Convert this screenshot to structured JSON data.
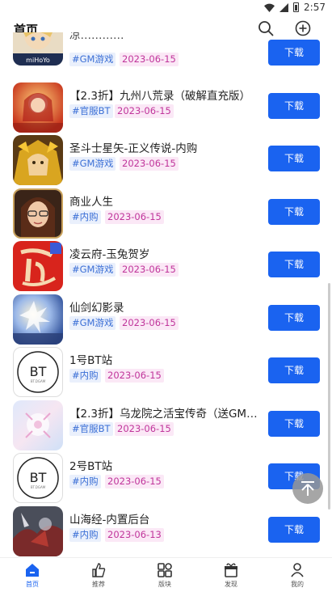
{
  "status_bar": {
    "time": "2:57"
  },
  "header": {
    "title": "首页"
  },
  "games": [
    {
      "title": "凉…………",
      "type_tag": "#GM游戏",
      "date": "2023-06-15",
      "button": "下载"
    },
    {
      "title": "【2.3折】九州八荒录（破解直充版）",
      "type_tag": "#官服BT",
      "date": "2023-06-15",
      "button": "下载"
    },
    {
      "title": "圣斗士星矢-正义传说-内购",
      "type_tag": "#GM游戏",
      "date": "2023-06-15",
      "button": "下载"
    },
    {
      "title": "商业人生",
      "type_tag": "#内购",
      "date": "2023-06-15",
      "button": "下载"
    },
    {
      "title": "凌云府-玉兔贺岁",
      "type_tag": "#GM游戏",
      "date": "2023-06-15",
      "button": "下载"
    },
    {
      "title": "仙剑幻影录",
      "type_tag": "#GM游戏",
      "date": "2023-06-15",
      "button": "下载"
    },
    {
      "title": "1号BT站",
      "type_tag": "#内购",
      "date": "2023-06-15",
      "button": "下载"
    },
    {
      "title": "【2.3折】乌龙院之活宝传奇（送GM…",
      "type_tag": "#官服BT",
      "date": "2023-06-15",
      "button": "下载"
    },
    {
      "title": "2号BT站",
      "type_tag": "#内购",
      "date": "2023-06-15",
      "button": "下载"
    },
    {
      "title": "山海经-内置后台",
      "type_tag": "#内购",
      "date": "2023-06-13",
      "button": "下载"
    }
  ],
  "icon_texts": {
    "first": "miHoYo",
    "bt_logo": "BT",
    "bt_sub": "BT.DGAM"
  },
  "tabs": [
    {
      "label": "首页",
      "icon": "home-icon",
      "active": true
    },
    {
      "label": "推荐",
      "icon": "thumbs-up-icon"
    },
    {
      "label": "版块",
      "icon": "grid-icon"
    },
    {
      "label": "发现",
      "icon": "gift-icon"
    },
    {
      "label": "我的",
      "icon": "user-icon"
    }
  ],
  "colors": {
    "accent": "#1a63f0",
    "type_tag_bg": "#eaf0fc",
    "date_tag_bg": "#fbe8f6",
    "date_tag_text": "#c0359b"
  }
}
